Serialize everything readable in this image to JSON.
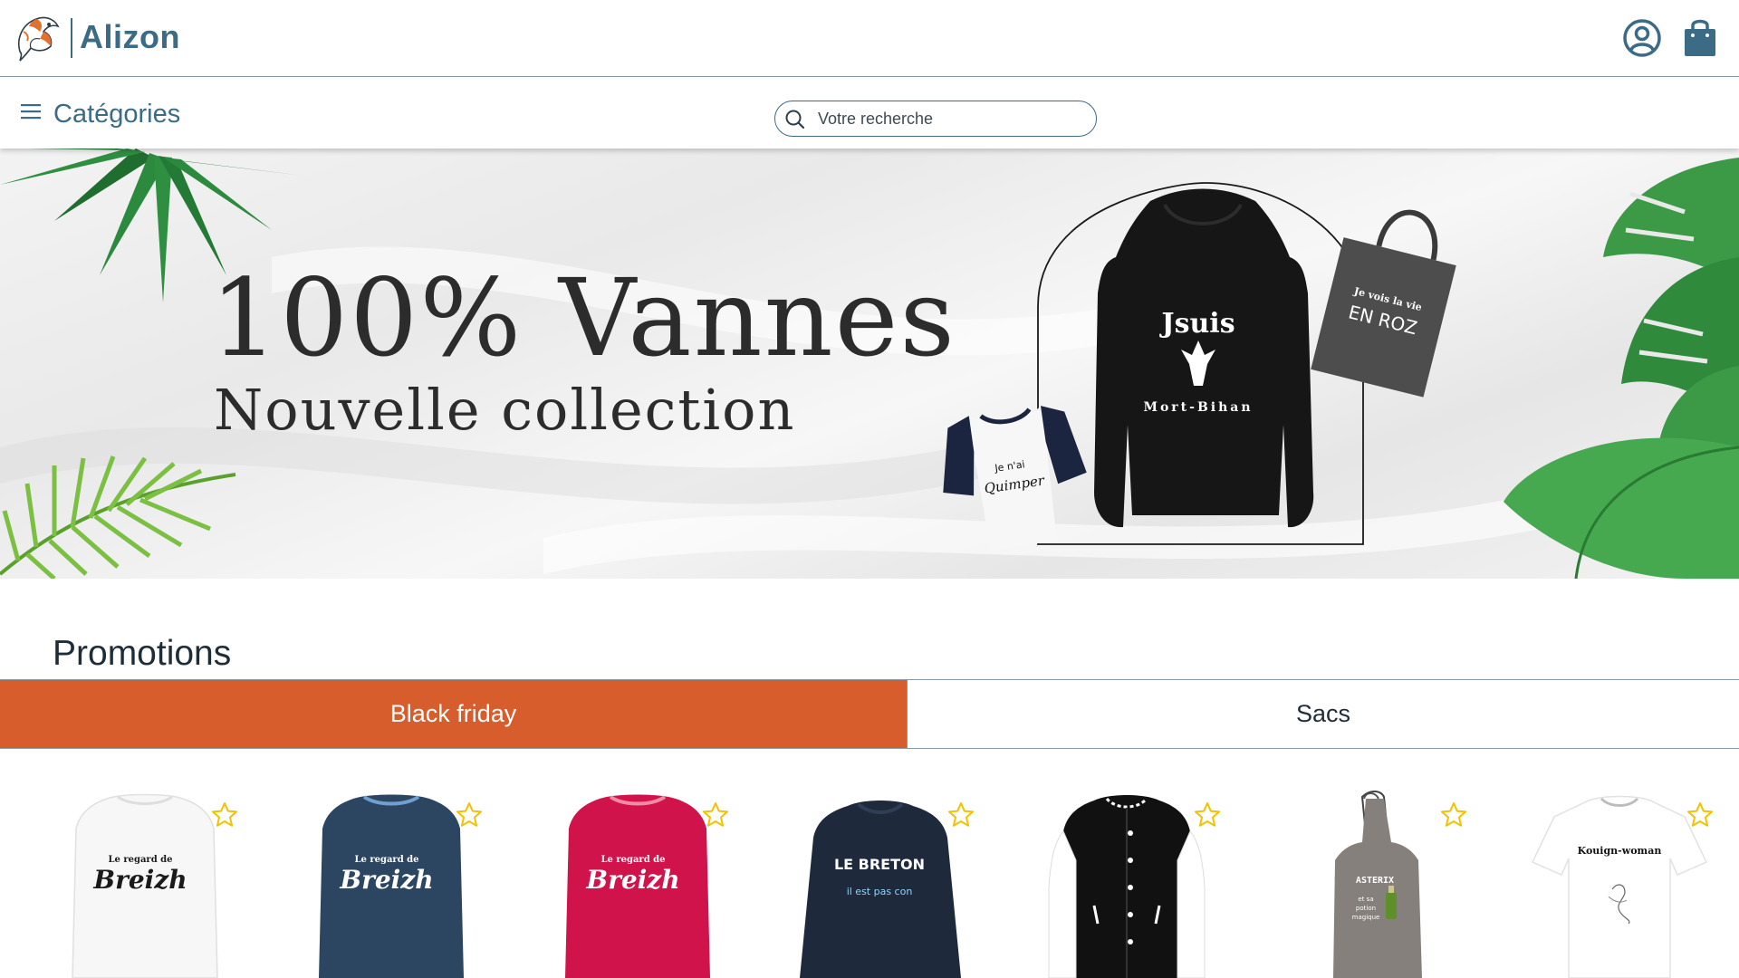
{
  "header": {
    "brand": "Alizon",
    "logo_icon": "koi-fish-logo-icon",
    "account_icon": "user-circle-icon",
    "cart_icon": "shopping-bag-icon",
    "brand_color": "#3c6b86"
  },
  "nav": {
    "menu_icon": "hamburger-menu-icon",
    "categories_label": "Catégories",
    "search_placeholder": "Votre recherche",
    "search_icon": "search-icon"
  },
  "hero": {
    "title": "100% Vannes",
    "subtitle": "Nouvelle collection",
    "hoodie_text_top": "Jsuis",
    "hoodie_text_bottom": "Mort-Bihan",
    "tote_text_top": "Je vois la vie",
    "tote_text_bottom": "EN ROZ",
    "tee_text_top": "Je n'ai",
    "tee_text_bottom": "Quimper"
  },
  "promotions": {
    "title": "Promotions",
    "tabs": [
      {
        "label": "Black friday",
        "active": true
      },
      {
        "label": "Sacs",
        "active": false
      }
    ],
    "accent_color": "#d75d2c"
  },
  "products": [
    {
      "type": "long-sleeve-shirt",
      "color": "#f7f7f7",
      "line1": "Le regard de",
      "line2": "Breizh",
      "text_color": "#1a1a1a"
    },
    {
      "type": "long-sleeve-shirt",
      "color": "#2c4662",
      "line1": "Le regard de",
      "line2": "Breizh",
      "text_color": "#ffffff"
    },
    {
      "type": "long-sleeve-shirt",
      "color": "#d0134a",
      "line1": "Le regard de",
      "line2": "Breizh",
      "text_color": "#ffffff"
    },
    {
      "type": "sweatshirt",
      "color": "#1e2a3c",
      "line1": "LE BRETON",
      "line2": "il est pas con",
      "text_color": "#ffffff"
    },
    {
      "type": "varsity-jacket",
      "color": "#111111",
      "line1": "",
      "line2": "",
      "text_color": "#ffffff"
    },
    {
      "type": "apron",
      "color": "#86807c",
      "line1": "ASTERIX",
      "line2": "et sa potion magique",
      "text_color": "#ffffff"
    },
    {
      "type": "tshirt",
      "color": "#ffffff",
      "line1": "Kouign-woman",
      "line2": "",
      "text_color": "#111111"
    }
  ],
  "favorite_icon": "star-outline-icon",
  "favorite_color": "#f2c200"
}
